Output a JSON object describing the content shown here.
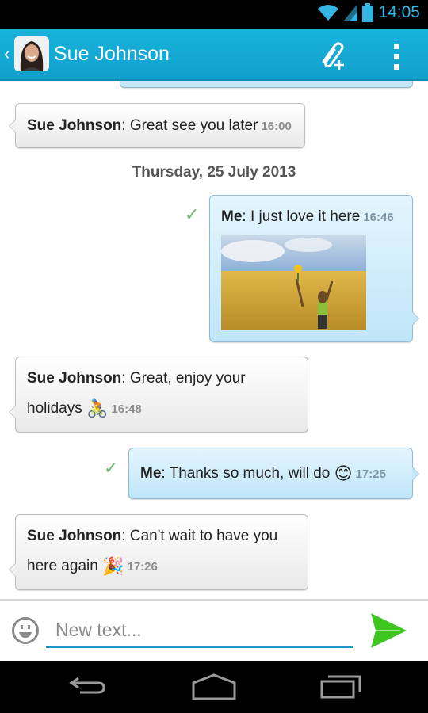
{
  "status_bar": {
    "time": "14:05",
    "icons": [
      "wifi-icon",
      "signal-icon",
      "battery-icon"
    ]
  },
  "app_bar": {
    "contact_name": "Sue Johnson",
    "actions": [
      "attach-icon",
      "overflow-menu-icon"
    ]
  },
  "messages": [
    {
      "direction": "in",
      "sender": "Sue Johnson",
      "text": "Great see you later",
      "time": "16:00"
    },
    {
      "type": "date",
      "text": "Thursday, 25 July 2013"
    },
    {
      "direction": "out",
      "sender": "Me",
      "text": "I just love it here",
      "time": "16:46",
      "attachment": "photo-woman-in-wheat-field",
      "delivered": true
    },
    {
      "direction": "in",
      "sender": "Sue Johnson",
      "text_line1": "Great, enjoy your",
      "text_line2": "holidays",
      "emoji": "🚴",
      "time": "16:48"
    },
    {
      "direction": "out",
      "sender": "Me",
      "text": "Thanks so much, will do",
      "emoji": "😊",
      "time": "17:25",
      "delivered": true
    },
    {
      "direction": "in",
      "sender": "Sue Johnson",
      "text_line1": "Can't wait to have you",
      "text_line2": "here again",
      "emoji": "🎉",
      "time": "17:26"
    }
  ],
  "composer": {
    "placeholder": "New text...",
    "value": ""
  },
  "colors": {
    "accent": "#17b4dc",
    "send": "#3ec51f",
    "check": "#6fb46f"
  },
  "punct": {
    "colon": ": "
  }
}
